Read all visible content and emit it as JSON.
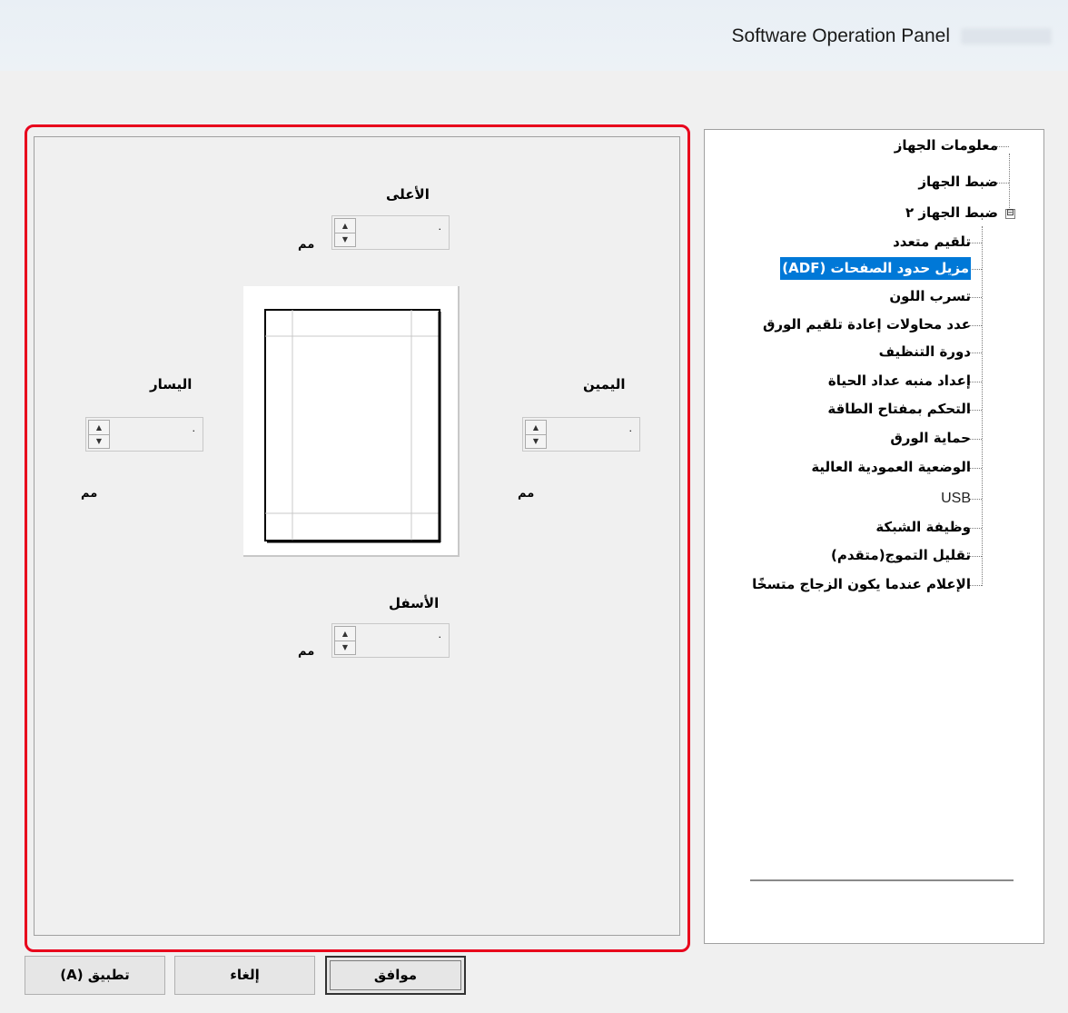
{
  "window": {
    "title": "Software Operation Panel"
  },
  "tree": {
    "items": [
      {
        "label": "معلومات الجهاز"
      },
      {
        "label": "ضبط الجهاز"
      },
      {
        "label": "ضبط الجهاز ٢",
        "expander": "⊟"
      },
      {
        "label": "تلقيم متعدد"
      },
      {
        "label": "مزيل حدود الصفحات (ADF)",
        "selected": true
      },
      {
        "label": "تسرب اللون"
      },
      {
        "label": "عدد محاولات إعادة تلقيم الورق"
      },
      {
        "label": "دورة التنظيف"
      },
      {
        "label": "إعداد منبه عداد الحياة"
      },
      {
        "label": "التحكم بمفتاح الطاقة"
      },
      {
        "label": "حماية الورق"
      },
      {
        "label": "الوضعية العمودية العالية"
      },
      {
        "label": "USB"
      },
      {
        "label": "وظيفة الشبكة"
      },
      {
        "label": "تقليل التموج(متقدم)"
      },
      {
        "label": "الإعلام عندما يكون الزجاج متسخًا"
      }
    ]
  },
  "margins": {
    "top": {
      "label": "الأعلى",
      "unit": "مم",
      "value": "·"
    },
    "left": {
      "label": "اليسار",
      "unit": "مم",
      "value": "·"
    },
    "right": {
      "label": "اليمين",
      "unit": "مم",
      "value": "·"
    },
    "bottom": {
      "label": "الأسفل",
      "unit": "مم",
      "value": "·"
    }
  },
  "buttons": {
    "ok": "موافق",
    "cancel": "إلغاء",
    "apply": "تطبيق (A)"
  },
  "colors": {
    "highlight_border": "#e8001c",
    "selection": "#0078d7"
  },
  "icons": {
    "spin_up": "up-arrow-icon",
    "spin_down": "down-arrow-icon",
    "tree_expander": "minus-box-icon"
  }
}
